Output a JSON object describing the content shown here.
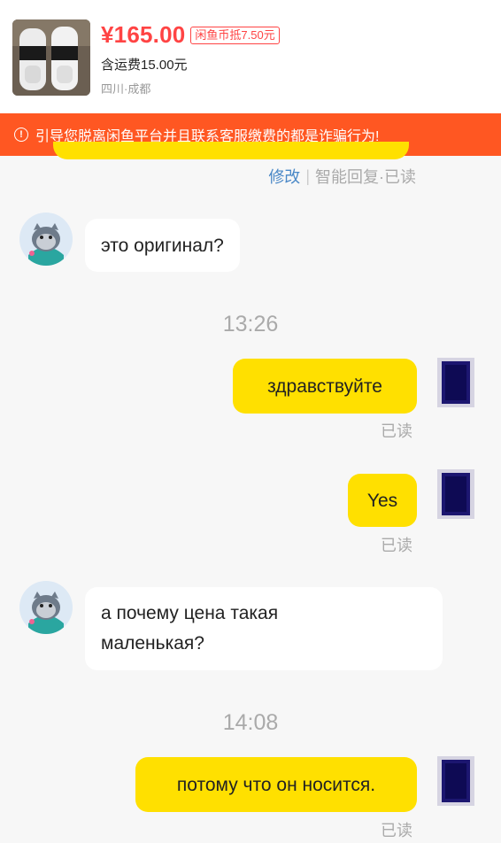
{
  "product": {
    "price": "¥165.00",
    "coin_badge": "闲鱼币抵7.50元",
    "shipping": "含运费15.00元",
    "location": "四川·成都"
  },
  "warning": {
    "icon": "alert-circle-icon",
    "text": "引导您脱离闲鱼平台并且联系客服缴费的都是诈骗行为!"
  },
  "edit_row": {
    "edit": "修改",
    "separator": "|",
    "status": "智能回复·已读"
  },
  "messages": [
    {
      "side": "in",
      "text": "это оригинал?"
    },
    {
      "type": "time",
      "text": "13:26"
    },
    {
      "side": "out",
      "text": "здравствуйте",
      "status": "已读"
    },
    {
      "side": "out",
      "text": "Yes",
      "status": "已读"
    },
    {
      "side": "in",
      "text": "а почему цена такая маленькая?"
    },
    {
      "type": "time",
      "text": "14:08"
    },
    {
      "side": "out",
      "text": "потому что он носится.",
      "status": "已读"
    }
  ],
  "colors": {
    "price": "#ff4444",
    "banner": "#ff5722",
    "bubble_out": "#ffe000",
    "bubble_in": "#ffffff",
    "edit_link": "#4a88c7"
  }
}
